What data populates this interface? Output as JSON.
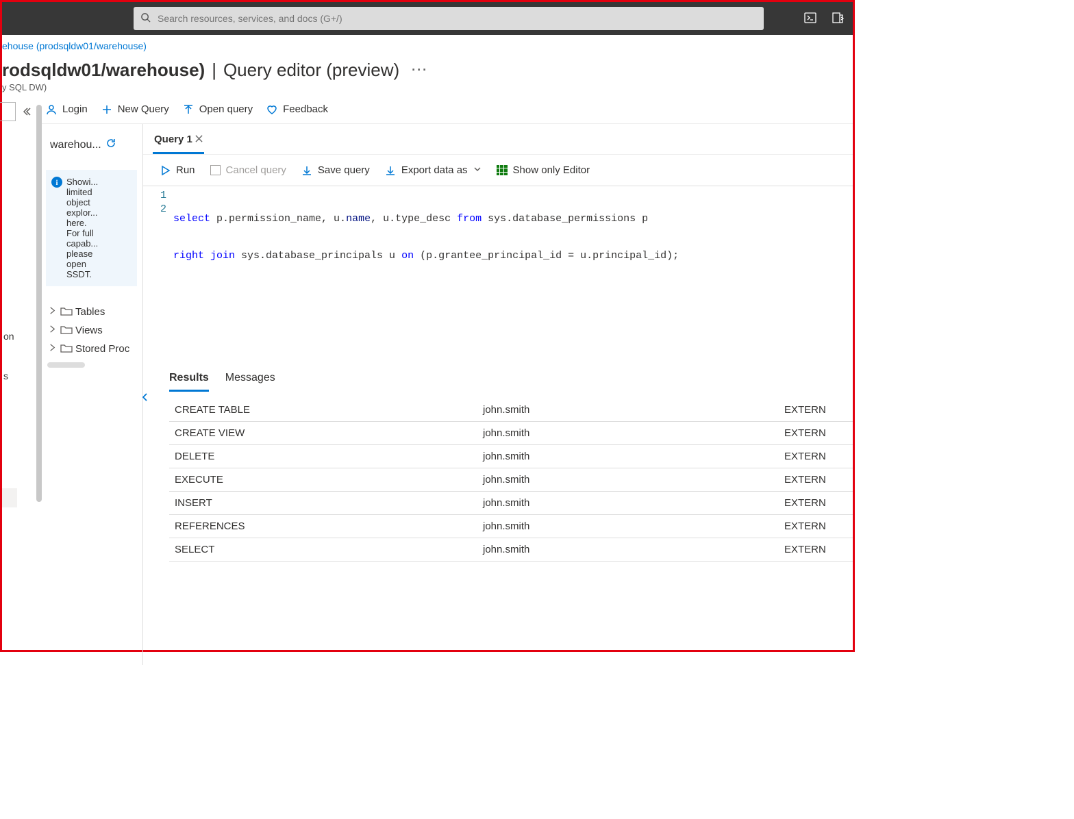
{
  "search": {
    "placeholder": "Search resources, services, and docs (G+/)"
  },
  "breadcrumb": {
    "text": "ehouse (prodsqldw01/warehouse)"
  },
  "header": {
    "title_left": "rodsqldw01/warehouse)",
    "title_sep": " | ",
    "title_right": "Query editor (preview)",
    "subtitle": "y SQL DW)"
  },
  "left_partial": {
    "item1": "on",
    "item2": "s"
  },
  "toolbar": {
    "login": "Login",
    "newquery": "New Query",
    "openquery": "Open query",
    "feedback": "Feedback"
  },
  "sidebar": {
    "dbname": "warehou...",
    "info_lines": [
      "Showi...",
      "limited",
      "object",
      "explor...",
      "here.",
      "For full",
      "capab...",
      "please",
      "open",
      "SSDT."
    ],
    "tree": {
      "tables": "Tables",
      "views": "Views",
      "sprocs": "Stored Proc"
    }
  },
  "query": {
    "tab_label": "Query 1",
    "actions": {
      "run": "Run",
      "cancel": "Cancel query",
      "save": "Save query",
      "export": "Export data as",
      "showonly": "Show only Editor"
    },
    "lines": {
      "n1": "1",
      "n2": "2"
    },
    "sql": {
      "l1": {
        "k1": "select",
        "t1": " p.permission_name, u.",
        "p1": "name",
        "t2": ", u.type_desc ",
        "k2": "from",
        "t3": " sys.database_permissions p"
      },
      "l2": {
        "k1": "right join",
        "t1": " sys.database_principals u ",
        "k2": "on",
        "t2": " (p.grantee_principal_id = u.principal_id);"
      }
    }
  },
  "results": {
    "tab_results": "Results",
    "tab_messages": "Messages",
    "rows": [
      {
        "c1": "CREATE TABLE",
        "c2": "john.smith",
        "c3": "EXTERN"
      },
      {
        "c1": "CREATE VIEW",
        "c2": "john.smith",
        "c3": "EXTERN"
      },
      {
        "c1": "DELETE",
        "c2": "john.smith",
        "c3": "EXTERN"
      },
      {
        "c1": "EXECUTE",
        "c2": "john.smith",
        "c3": "EXTERN"
      },
      {
        "c1": "INSERT",
        "c2": "john.smith",
        "c3": "EXTERN"
      },
      {
        "c1": "REFERENCES",
        "c2": "john.smith",
        "c3": "EXTERN"
      },
      {
        "c1": "SELECT",
        "c2": "john.smith",
        "c3": "EXTERN"
      }
    ]
  }
}
